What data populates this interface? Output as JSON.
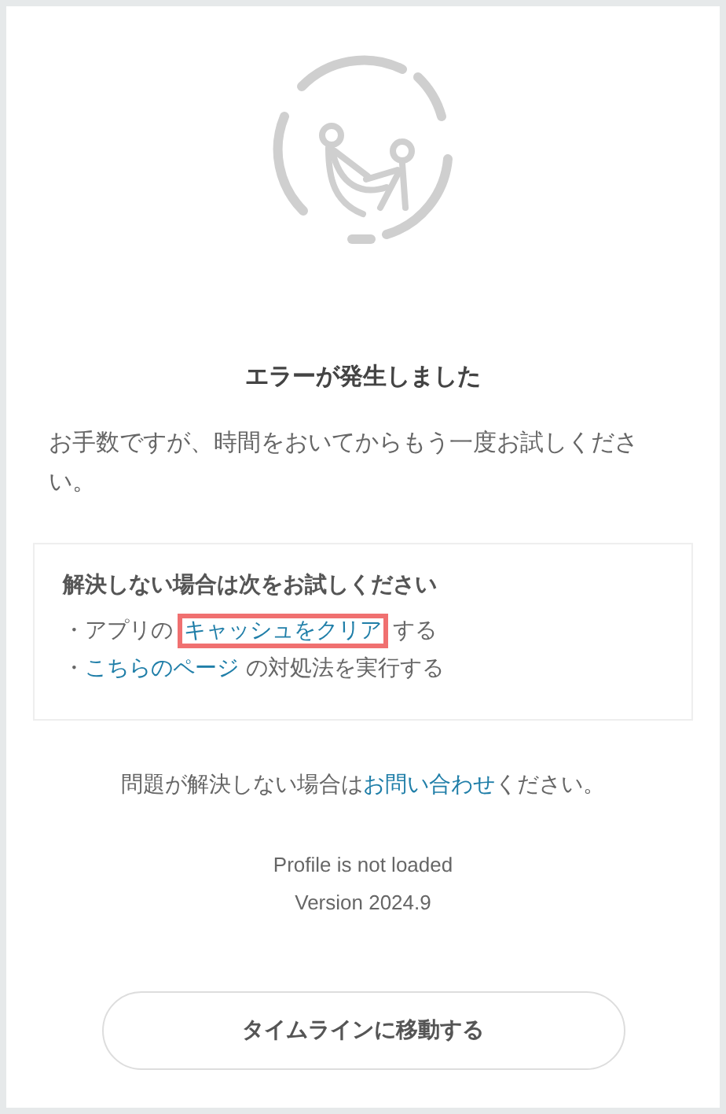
{
  "title": "エラーが発生しました",
  "message": "お手数ですが、時間をおいてからもう一度お試しください。",
  "tips": {
    "heading": "解決しない場合は次をお試しください",
    "items": [
      {
        "bullet": "・",
        "parts": [
          {
            "text": "アプリの",
            "kind": "text",
            "highlighted": false
          },
          {
            "text": "キャッシュをクリア",
            "kind": "link",
            "highlighted": true
          },
          {
            "text": "する",
            "kind": "text",
            "highlighted": false
          }
        ]
      },
      {
        "bullet": "・",
        "parts": [
          {
            "text": "こちらのページ",
            "kind": "link",
            "highlighted": false
          },
          {
            "text": " の対処法を実行する",
            "kind": "text",
            "highlighted": false
          }
        ]
      }
    ]
  },
  "contact": [
    {
      "text": "問題が解決しない場合は",
      "kind": "text"
    },
    {
      "text": "お問い合わせ",
      "kind": "link"
    },
    {
      "text": "ください。",
      "kind": "text"
    }
  ],
  "status": "Profile is not loaded",
  "version": "Version 2024.9",
  "button": "タイムラインに移動する"
}
